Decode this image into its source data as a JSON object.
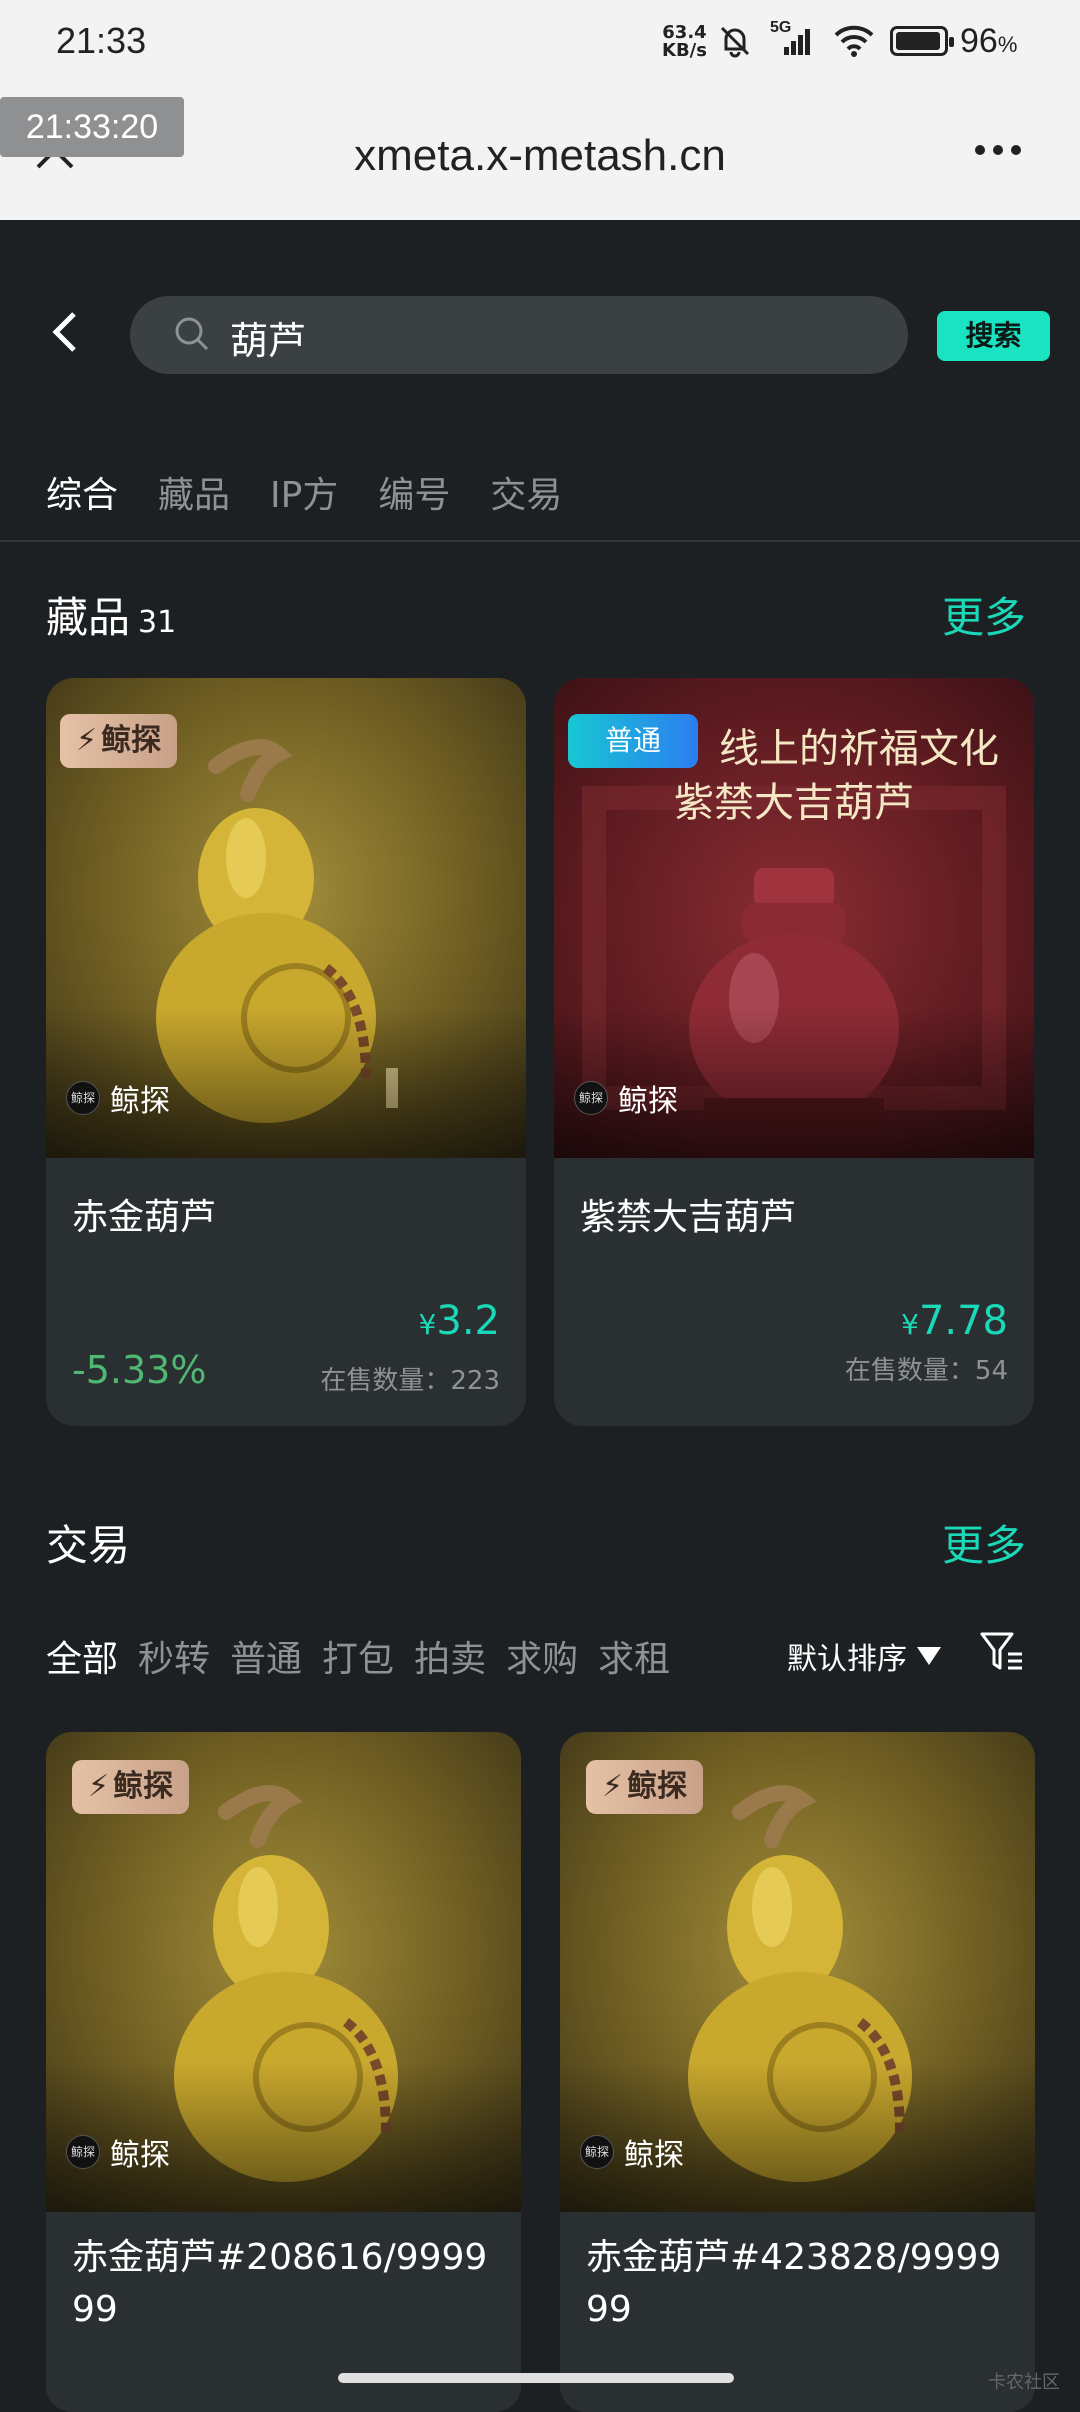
{
  "status_bar": {
    "time": "21:33",
    "net_speed_top": "63.4",
    "net_speed_bottom": "KB/s",
    "signal": "5G",
    "battery": "96",
    "battery_unit": "%"
  },
  "browser": {
    "url": "xmeta.x-metash.cn",
    "timestamp": "21:33:20"
  },
  "search": {
    "query": "葫芦",
    "button": "搜索"
  },
  "tabs": [
    "综合",
    "藏品",
    "IP方",
    "编号",
    "交易"
  ],
  "collections": {
    "title": "藏品",
    "count": "31",
    "more": "更多",
    "items": [
      {
        "badge": "鲸探",
        "owner": "鲸探",
        "owner_avatar": "鲸探",
        "name": "赤金葫芦",
        "price_symbol": "¥",
        "price": "3.2",
        "change": "-5.33%",
        "stock": "在售数量：223"
      },
      {
        "badge": "普通",
        "owner": "鲸探",
        "owner_avatar": "鲸探",
        "name": "紫禁大吉葫芦",
        "image_text_line1": "线上的祈福文化",
        "image_text_line2": "紫禁大吉葫芦",
        "price_symbol": "¥",
        "price": "7.78",
        "stock": "在售数量：54"
      }
    ]
  },
  "trades": {
    "title": "交易",
    "more": "更多",
    "filters": [
      "全部",
      "秒转",
      "普通",
      "打包",
      "拍卖",
      "求购",
      "求租"
    ],
    "sort": "默认排序",
    "items": [
      {
        "badge": "鲸探",
        "owner": "鲸探",
        "owner_avatar": "鲸探",
        "name": "赤金葫芦#208616/999999"
      },
      {
        "badge": "鲸探",
        "owner": "鲸探",
        "owner_avatar": "鲸探",
        "name": "赤金葫芦#423828/999999"
      }
    ]
  },
  "watermark": "卡农社区",
  "colors": {
    "accent": "#1ad8b8",
    "background": "#1d2022",
    "card": "#2a2f31",
    "negative_change": "#4fb872"
  }
}
